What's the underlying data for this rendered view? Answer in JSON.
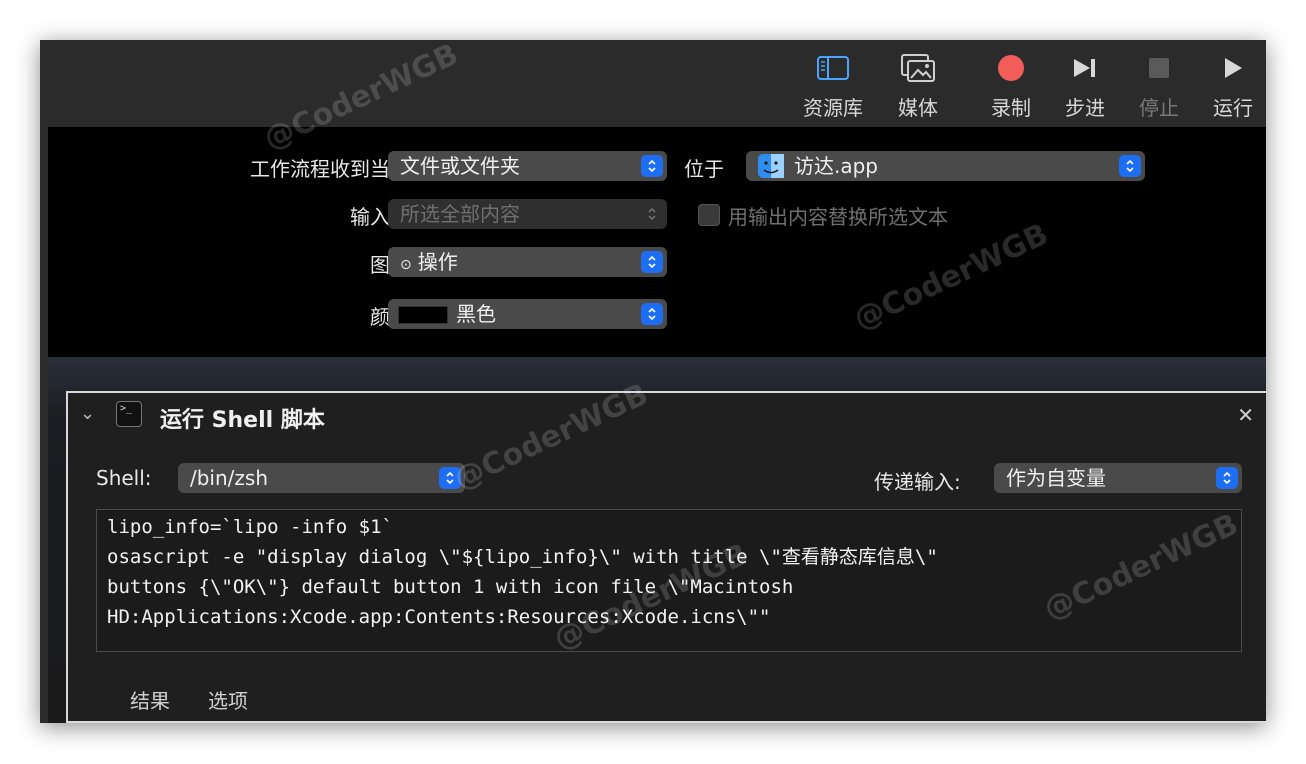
{
  "toolbar": {
    "library_label": "资源库",
    "media_label": "媒体",
    "record_label": "录制",
    "step_label": "步进",
    "stop_label": "停止",
    "run_label": "运行",
    "record_color": "#f25d5a",
    "accent_color": "#4aa3ff"
  },
  "workflow": {
    "receives_label": "工作流程收到当前",
    "receives_value": "文件或文件夹",
    "in_label": "位于",
    "in_value": "访达.app",
    "input_label": "输入为",
    "input_value": "所选全部内容",
    "replace_label": "用输出内容替换所选文本",
    "image_label": "图像",
    "image_value": "操作",
    "color_label": "颜色",
    "color_value": "黑色"
  },
  "action": {
    "title": "运行 Shell 脚本",
    "shell_label": "Shell:",
    "shell_value": "/bin/zsh",
    "pass_label": "传递输入:",
    "pass_value": "作为自变量",
    "code_lines": [
      "lipo_info=`lipo -info $1`",
      "osascript -e \"display dialog \\\"${lipo_info}\\\" with title \\\"查看静态库信息\\\"",
      "buttons {\\\"OK\\\"} default button 1 with icon file \\\"Macintosh",
      "HD:Applications:Xcode.app:Contents:Resources:Xcode.icns\\\"\""
    ],
    "tab_results": "结果",
    "tab_options": "选项"
  },
  "watermark": "@CoderWGB"
}
